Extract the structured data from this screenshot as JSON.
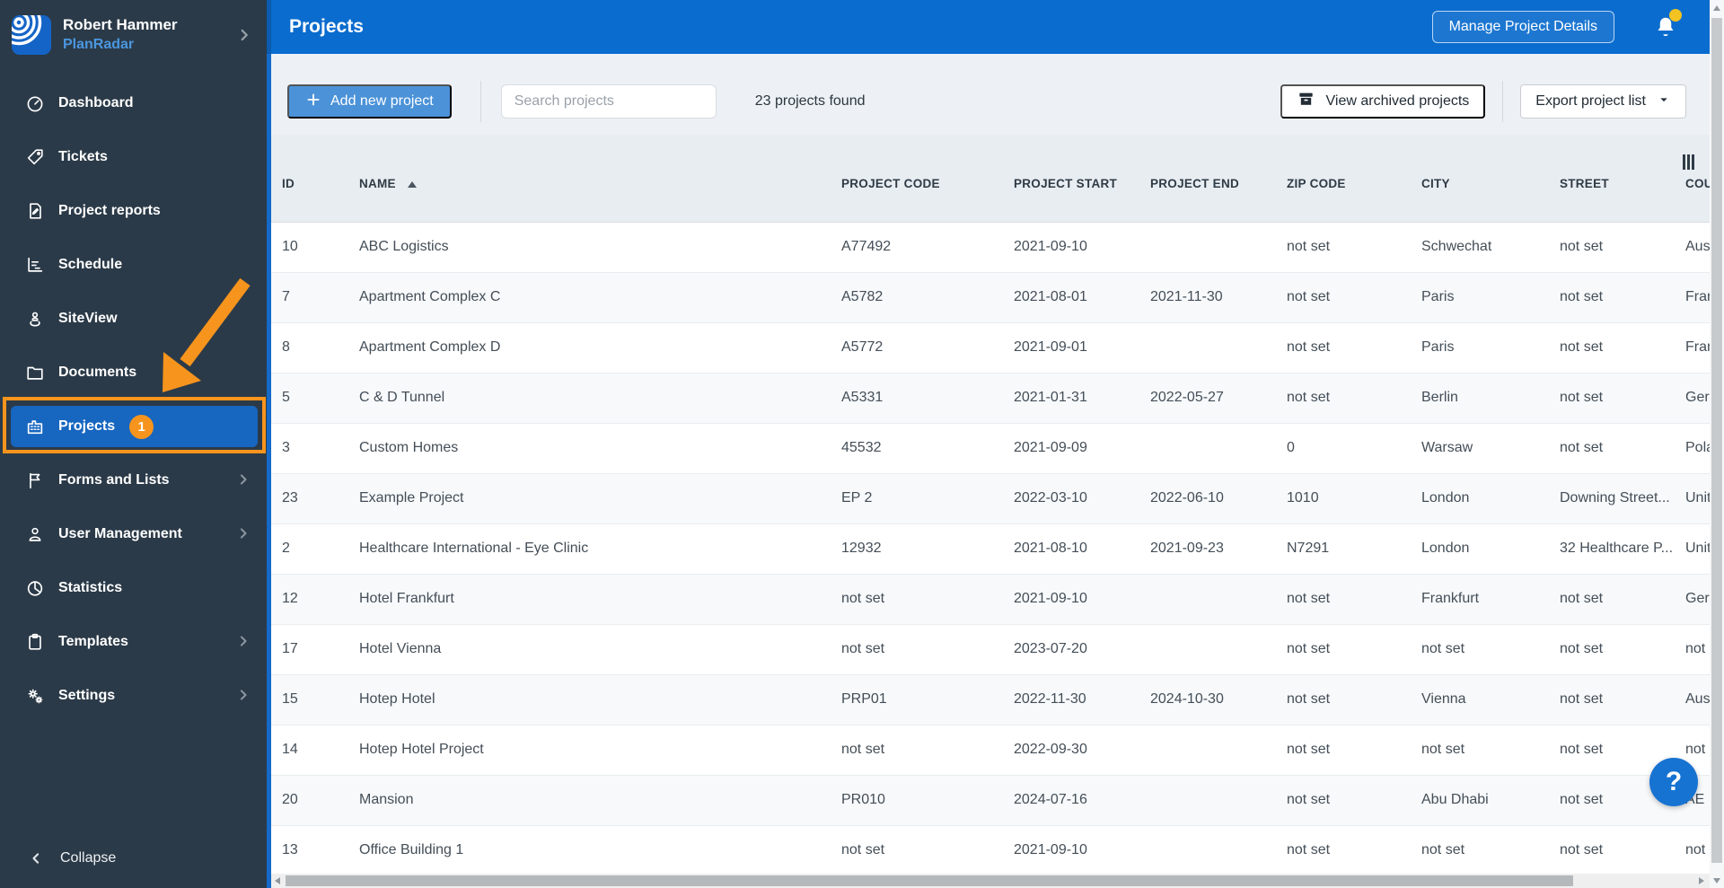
{
  "colors": {
    "header_blue": "#0a6cce",
    "sidebar_dark": "#2b3a48",
    "active_blue": "#1766c0",
    "strip_blue": "#1569c8",
    "accent_orange": "#f7941d",
    "badge_yellow": "#f3c321",
    "help_blue": "#1673d2"
  },
  "sidebar": {
    "user": {
      "name": "Robert Hammer",
      "org": "PlanRadar"
    },
    "items": [
      {
        "id": "dashboard",
        "label": "Dashboard",
        "icon": "dashboard"
      },
      {
        "id": "tickets",
        "label": "Tickets",
        "icon": "tag"
      },
      {
        "id": "project-reports",
        "label": "Project reports",
        "icon": "report"
      },
      {
        "id": "schedule",
        "label": "Schedule",
        "icon": "schedule"
      },
      {
        "id": "siteview",
        "label": "SiteView",
        "icon": "siteview"
      },
      {
        "id": "documents",
        "label": "Documents",
        "icon": "folder"
      },
      {
        "id": "projects",
        "label": "Projects",
        "icon": "building",
        "active": true,
        "badge": "1"
      },
      {
        "id": "forms-and-lists",
        "label": "Forms and Lists",
        "icon": "flag",
        "chevron": true
      },
      {
        "id": "user-management",
        "label": "User Management",
        "icon": "user",
        "chevron": true
      },
      {
        "id": "statistics",
        "label": "Statistics",
        "icon": "pie"
      },
      {
        "id": "templates",
        "label": "Templates",
        "icon": "clipboard",
        "chevron": true
      },
      {
        "id": "settings",
        "label": "Settings",
        "icon": "gears",
        "chevron": true
      }
    ],
    "collapse_label": "Collapse"
  },
  "header": {
    "title": "Projects",
    "manage_button": "Manage Project Details"
  },
  "toolbar": {
    "add_button": "Add new project",
    "search_placeholder": "Search projects",
    "count_text": "23 projects found",
    "archived_button": "View archived projects",
    "export_button": "Export project list"
  },
  "table": {
    "columns": [
      {
        "key": "id",
        "label": "ID"
      },
      {
        "key": "name",
        "label": "NAME",
        "sorted": "asc"
      },
      {
        "key": "code",
        "label": "PROJECT CODE"
      },
      {
        "key": "start",
        "label": "PROJECT START"
      },
      {
        "key": "end",
        "label": "PROJECT END"
      },
      {
        "key": "zip",
        "label": "ZIP CODE"
      },
      {
        "key": "city",
        "label": "CITY"
      },
      {
        "key": "street",
        "label": "STREET"
      },
      {
        "key": "country",
        "label": "COUNTRY"
      }
    ],
    "rows": [
      {
        "id": "10",
        "name": "ABC Logistics",
        "code": "A77492",
        "start": "2021-09-10",
        "end": "",
        "zip": "not set",
        "city": "Schwechat",
        "street": "not set",
        "country": "Austria"
      },
      {
        "id": "7",
        "name": "Apartment Complex C",
        "code": "A5782",
        "start": "2021-08-01",
        "end": "2021-11-30",
        "zip": "not set",
        "city": "Paris",
        "street": "not set",
        "country": "France"
      },
      {
        "id": "8",
        "name": "Apartment Complex D",
        "code": "A5772",
        "start": "2021-09-01",
        "end": "",
        "zip": "not set",
        "city": "Paris",
        "street": "not set",
        "country": "France"
      },
      {
        "id": "5",
        "name": "C & D Tunnel",
        "code": "A5331",
        "start": "2021-01-31",
        "end": "2022-05-27",
        "zip": "not set",
        "city": "Berlin",
        "street": "not set",
        "country": "Germany"
      },
      {
        "id": "3",
        "name": "Custom Homes",
        "code": "45532",
        "start": "2021-09-09",
        "end": "",
        "zip": "0",
        "city": "Warsaw",
        "street": "not set",
        "country": "Poland"
      },
      {
        "id": "23",
        "name": "Example Project",
        "code": "EP 2",
        "start": "2022-03-10",
        "end": "2022-06-10",
        "zip": "1010",
        "city": "London",
        "street": "Downing Street...",
        "country": "United Kingdom"
      },
      {
        "id": "2",
        "name": "Healthcare International - Eye Clinic",
        "code": "12932",
        "start": "2021-08-10",
        "end": "2021-09-23",
        "zip": "N7291",
        "city": "London",
        "street": "32 Healthcare P...",
        "country": "United Kingdom"
      },
      {
        "id": "12",
        "name": "Hotel Frankfurt",
        "code": "not set",
        "start": "2021-09-10",
        "end": "",
        "zip": "not set",
        "city": "Frankfurt",
        "street": "not set",
        "country": "Germany"
      },
      {
        "id": "17",
        "name": "Hotel Vienna",
        "code": "not set",
        "start": "2023-07-20",
        "end": "",
        "zip": "not set",
        "city": "not set",
        "street": "not set",
        "country": "not set"
      },
      {
        "id": "15",
        "name": "Hotep Hotel",
        "code": "PRP01",
        "start": "2022-11-30",
        "end": "2024-10-30",
        "zip": "not set",
        "city": "Vienna",
        "street": "not set",
        "country": "Austria"
      },
      {
        "id": "14",
        "name": "Hotep Hotel Project",
        "code": "not set",
        "start": "2022-09-30",
        "end": "",
        "zip": "not set",
        "city": "not set",
        "street": "not set",
        "country": "not set"
      },
      {
        "id": "20",
        "name": "Mansion",
        "code": "PR010",
        "start": "2024-07-16",
        "end": "",
        "zip": "not set",
        "city": "Abu Dhabi",
        "street": "not set",
        "country": "AE"
      },
      {
        "id": "13",
        "name": "Office Building 1",
        "code": "not set",
        "start": "2021-09-10",
        "end": "",
        "zip": "not set",
        "city": "not set",
        "street": "not set",
        "country": "not set"
      }
    ]
  },
  "help_label": "?"
}
